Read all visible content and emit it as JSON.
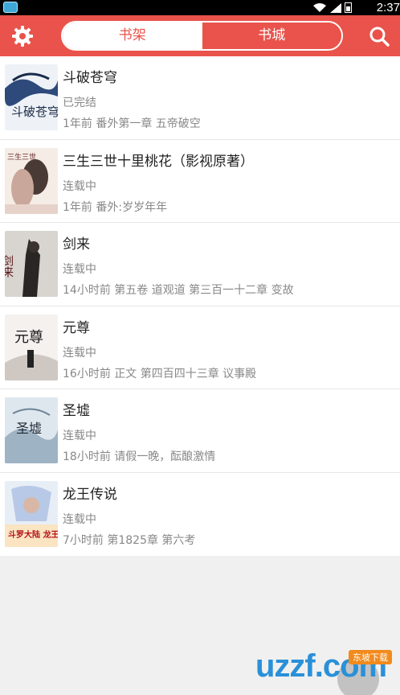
{
  "status_bar": {
    "time": "2:37"
  },
  "header": {
    "tabs": [
      {
        "label": "书架",
        "active": true
      },
      {
        "label": "书城",
        "active": false
      }
    ]
  },
  "books": [
    {
      "title": "斗破苍穹",
      "status": "已完结",
      "latest": "1年前  番外第一章 五帝破空",
      "cover_text": "斗破苍穹"
    },
    {
      "title": "三生三世十里桃花（影视原著）",
      "status": "连载中",
      "latest": "1年前 番外:岁岁年年",
      "cover_text": "三生三世"
    },
    {
      "title": "剑来",
      "status": "连载中",
      "latest": "14小时前 第五卷 道观道 第三百一十二章 变故",
      "cover_text": "剑来"
    },
    {
      "title": "元尊",
      "status": "连载中",
      "latest": "16小时前 正文 第四百四十三章 议事殿",
      "cover_text": "元尊"
    },
    {
      "title": "圣墟",
      "status": "连载中",
      "latest": "18小时前 请假一晚，酝酿激情",
      "cover_text": "圣墟"
    },
    {
      "title": "龙王传说",
      "status": "连载中",
      "latest": "7小时前 第1825章 第六考",
      "cover_text": "斗罗大陆 龙王传说"
    }
  ],
  "watermark": {
    "logo": "uzzf.com",
    "badge": "东坡下载"
  },
  "colors": {
    "accent": "#e9534b",
    "text_primary": "#222222",
    "text_secondary": "#888888"
  }
}
